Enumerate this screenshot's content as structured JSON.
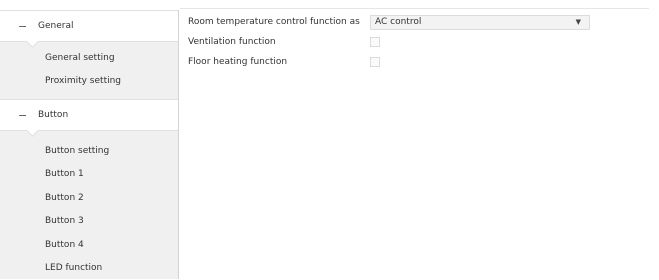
{
  "sidebar": {
    "groups": [
      {
        "toggle": "−",
        "label": "General",
        "items": [
          "General setting",
          "Proximity setting"
        ]
      },
      {
        "toggle": "−",
        "label": "Button",
        "items": [
          "Button setting",
          "Button 1",
          "Button 2",
          "Button 3",
          "Button 4",
          "LED function"
        ]
      }
    ]
  },
  "main": {
    "room_temp": {
      "label": "Room temperature control function as",
      "value": "AC control",
      "arrow": "▼"
    },
    "ventilation": {
      "label": "Ventilation function",
      "checked": false
    },
    "floor_heating": {
      "label": "Floor heating function",
      "checked": false
    }
  }
}
